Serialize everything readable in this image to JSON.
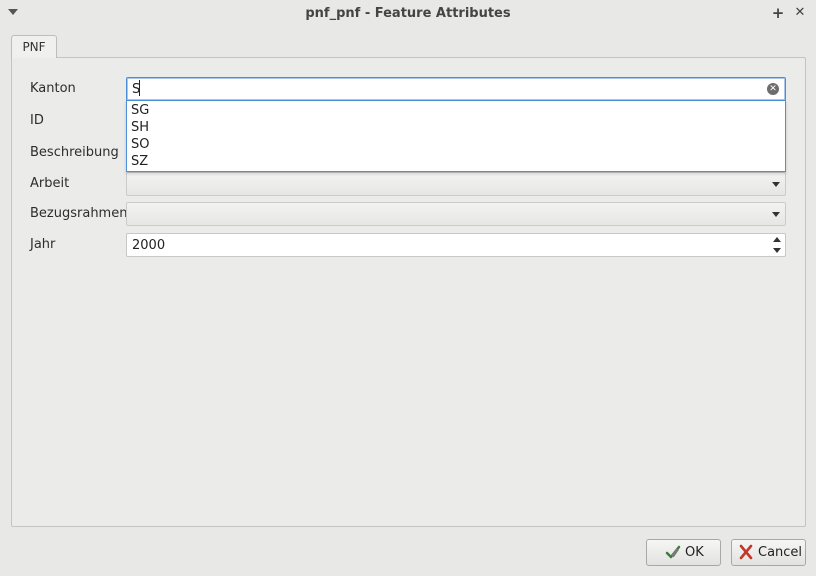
{
  "window": {
    "title": "pnf_pnf - Feature Attributes",
    "maximize_glyph": "+",
    "close_glyph": "✕"
  },
  "tabs": [
    {
      "label": "PNF",
      "active": true
    }
  ],
  "form": {
    "kanton": {
      "label": "Kanton",
      "value": "S"
    },
    "id": {
      "label": "ID",
      "value": ""
    },
    "beschreibung": {
      "label": "Beschreibung",
      "value": ""
    },
    "arbeit": {
      "label": "Arbeit",
      "value": ""
    },
    "bezugsrahmen": {
      "label": "Bezugsrahmen",
      "value": ""
    },
    "jahr": {
      "label": "Jahr",
      "value": "2000"
    }
  },
  "autocomplete": {
    "options": [
      "SG",
      "SH",
      "SO",
      "SZ"
    ]
  },
  "buttons": {
    "ok_label": "OK",
    "cancel_label": "Cancel"
  },
  "icons": {
    "window_menu": "chevron-down-icon",
    "clear": "clear-icon",
    "ok": "checkmark-pen-icon",
    "cancel": "red-x-icon"
  },
  "colors": {
    "focus": "#4a90d9",
    "background": "#e8e8e7",
    "cancel_icon": "#c0392b",
    "ok_icon": "#3f7d3a"
  }
}
